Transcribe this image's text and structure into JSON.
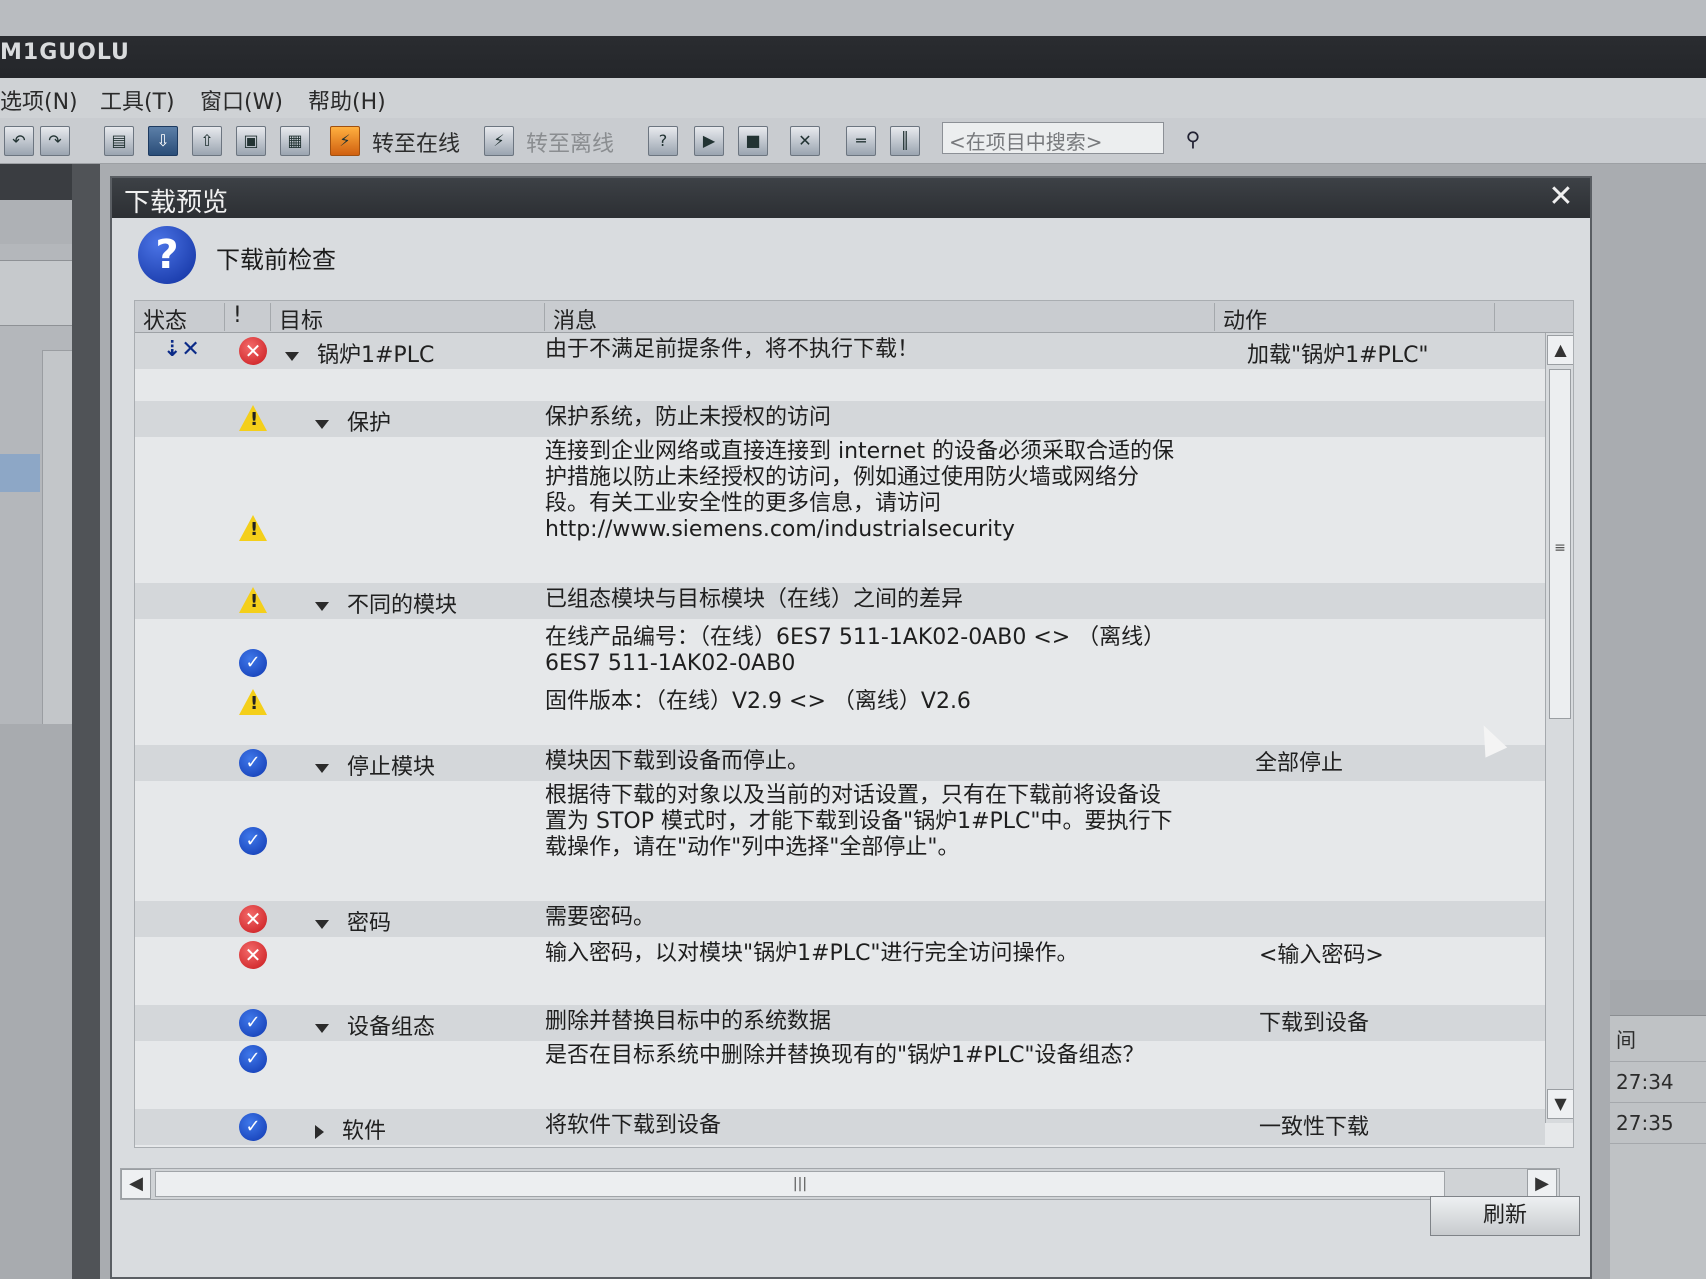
{
  "app": {
    "title": "M1GUOLU"
  },
  "menu": {
    "items": [
      "选项(N)",
      "工具(T)",
      "窗口(W)",
      "帮助(H)"
    ]
  },
  "toolbar": {
    "go_online": "转至在线",
    "go_offline": "转至离线",
    "search_placeholder": "<在项目中搜索>"
  },
  "dialog": {
    "title": "下载预览",
    "subtitle": "下载前检查",
    "columns": {
      "status": "状态",
      "bang": "!",
      "target": "目标",
      "message": "消息",
      "action": "动作"
    },
    "rows": [
      {
        "target": "锅炉1#PLC",
        "message": "由于不满足前提条件，将不执行下载！",
        "action": "加载\"锅炉1#PLC\""
      },
      {
        "target": "保护",
        "message": "保护系统，防止未授权的访问"
      },
      {
        "message": "连接到企业网络或直接连接到 internet 的设备必须采取合适的保护措施以防止未经授权的访问，例如通过使用防火墙或网络分段。有关工业安全性的更多信息，请访问 http://www.siemens.com/industrialsecurity"
      },
      {
        "target": "不同的模块",
        "message": "已组态模块与目标模块（在线）之间的差异"
      },
      {
        "message": "在线产品编号：（在线）6ES7 511-1AK02-0AB0 <> （离线）6ES7 511-1AK02-0AB0"
      },
      {
        "message": "固件版本：（在线）V2.9 <> （离线）V2.6"
      },
      {
        "target": "停止模块",
        "message": "模块因下载到设备而停止。",
        "action": "全部停止"
      },
      {
        "message": "根据待下载的对象以及当前的对话设置，只有在下载前将设备设置为 STOP 模式时，才能下载到设备\"锅炉1#PLC\"中。要执行下载操作，请在\"动作\"列中选择\"全部停止\"。"
      },
      {
        "target": "密码",
        "message": "需要密码。"
      },
      {
        "message": "输入密码，以对模块\"锅炉1#PLC\"进行完全访问操作。",
        "action": "<输入密码>"
      },
      {
        "target": "设备组态",
        "message": "删除并替换目标中的系统数据",
        "action": "下载到设备"
      },
      {
        "message": "是否在目标系统中删除并替换现有的\"锅炉1#PLC\"设备组态？"
      },
      {
        "target": "软件",
        "message": "将软件下载到设备",
        "action": "一致性下载"
      }
    ],
    "refresh_button": "刷新"
  },
  "right_panel": {
    "times": [
      "27:34",
      "27:35"
    ],
    "col_head": "间"
  },
  "colors": {
    "dialog_bg": "#d9dcdf",
    "title_bar": "#2c2f33",
    "error": "#c8181c",
    "ok": "#1038b0",
    "warning": "#f4cf1a"
  }
}
